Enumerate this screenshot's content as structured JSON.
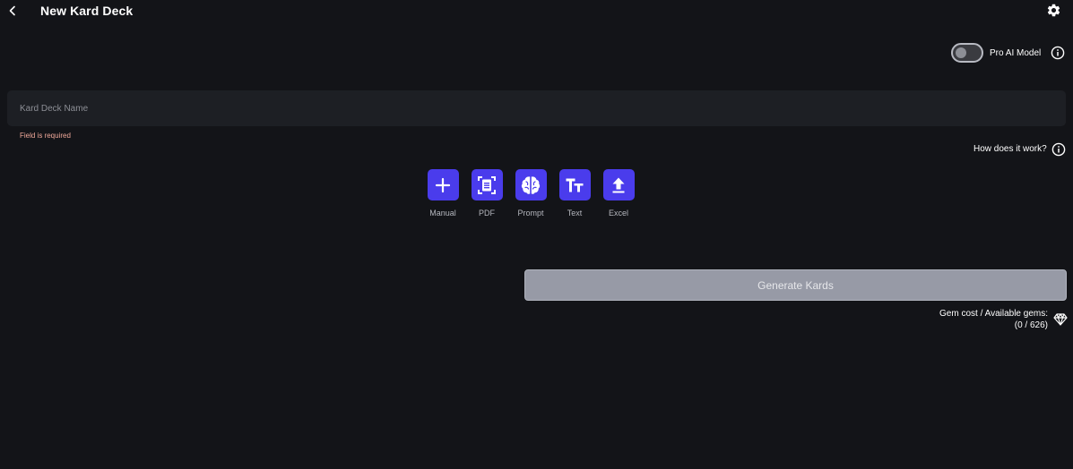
{
  "header": {
    "title": "New Kard Deck",
    "back_icon": "chevron-left-icon",
    "settings_icon": "gear-icon"
  },
  "pro_model": {
    "label": "Pro AI Model",
    "enabled": false,
    "info_icon": "info-circle-icon"
  },
  "deck_name": {
    "placeholder": "Kard Deck Name",
    "value": "",
    "error": "Field is required"
  },
  "help": {
    "label": "How does it work?",
    "icon": "info-circle-icon"
  },
  "sources": [
    {
      "label": "Manual",
      "icon": "plus-icon"
    },
    {
      "label": "PDF",
      "icon": "document-scan-icon"
    },
    {
      "label": "Prompt",
      "icon": "brain-icon"
    },
    {
      "label": "Text",
      "icon": "text-size-icon"
    },
    {
      "label": "Excel",
      "icon": "upload-icon"
    }
  ],
  "generate": {
    "label": "Generate Kards",
    "disabled": true
  },
  "gems": {
    "label": "Gem cost / Available gems:",
    "value": "(0 / 626)",
    "icon": "diamond-icon"
  },
  "colors": {
    "background": "#131418",
    "field": "#1d1f24",
    "accent": "#4a3cec",
    "error": "#f0a99a",
    "button_disabled": "#979aa6"
  }
}
